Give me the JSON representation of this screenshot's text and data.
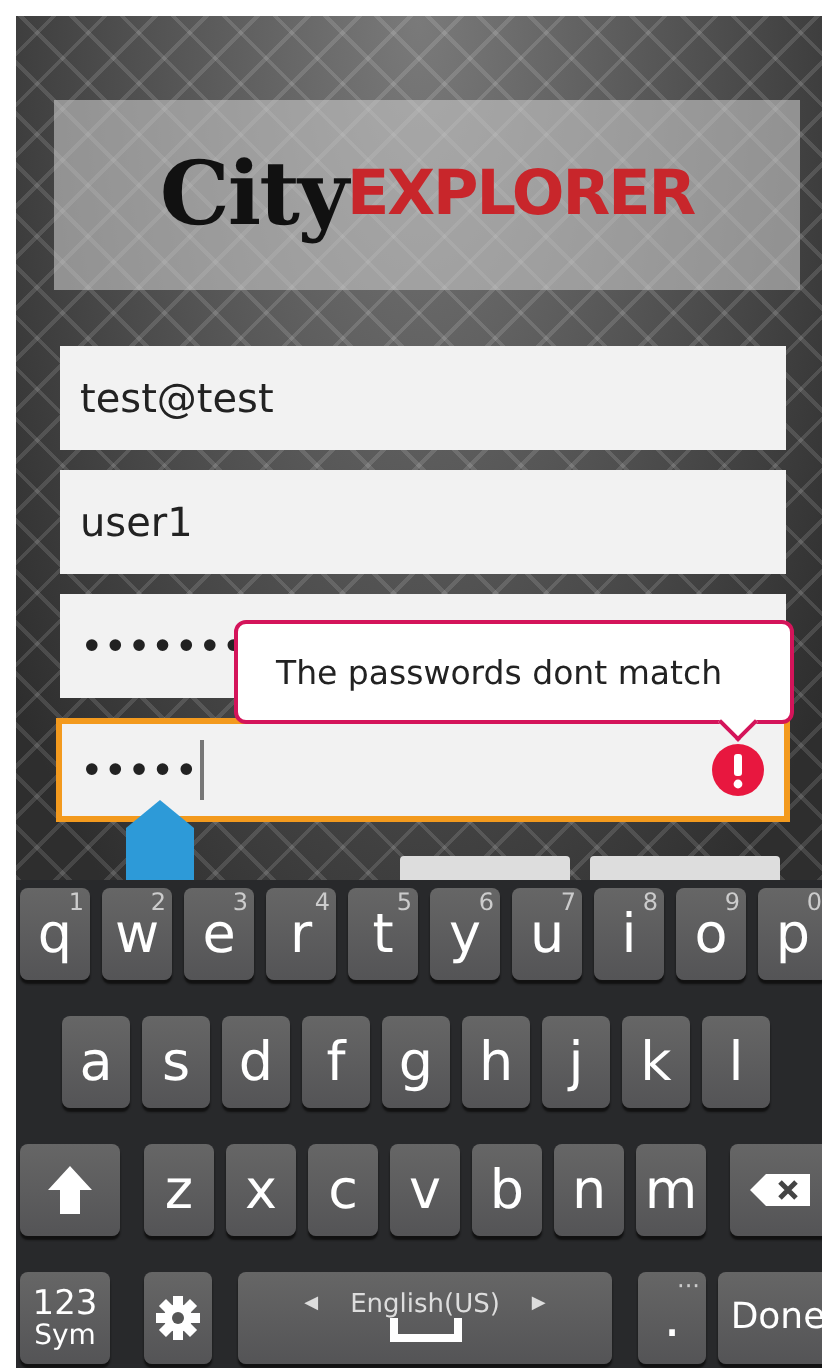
{
  "logo": {
    "word_1": "City",
    "word_2": "EXPLORER"
  },
  "fields": [
    {
      "value": "test@test",
      "focused": false
    },
    {
      "value": "user1",
      "focused": false
    },
    {
      "value": "•••••••",
      "focused": false
    },
    {
      "value": "•••••",
      "focused": true
    }
  ],
  "error_tooltip": {
    "text": "The passwords dont match"
  },
  "keyboard": {
    "letter_rows": [
      {
        "keys": [
          {
            "kind": "char",
            "label": "q",
            "hint": "1"
          },
          {
            "kind": "char",
            "label": "w",
            "hint": "2"
          },
          {
            "kind": "char",
            "label": "e",
            "hint": "3"
          },
          {
            "kind": "char",
            "label": "r",
            "hint": "4"
          },
          {
            "kind": "char",
            "label": "t",
            "hint": "5"
          },
          {
            "kind": "char",
            "label": "y",
            "hint": "6"
          },
          {
            "kind": "char",
            "label": "u",
            "hint": "7"
          },
          {
            "kind": "char",
            "label": "i",
            "hint": "8"
          },
          {
            "kind": "char",
            "label": "o",
            "hint": "9"
          },
          {
            "kind": "char",
            "label": "p",
            "hint": "0"
          }
        ]
      },
      {
        "keys": [
          {
            "kind": "char",
            "label": "a"
          },
          {
            "kind": "char",
            "label": "s"
          },
          {
            "kind": "char",
            "label": "d"
          },
          {
            "kind": "char",
            "label": "f"
          },
          {
            "kind": "char",
            "label": "g"
          },
          {
            "kind": "char",
            "label": "h"
          },
          {
            "kind": "char",
            "label": "j"
          },
          {
            "kind": "char",
            "label": "k"
          },
          {
            "kind": "char",
            "label": "l"
          }
        ]
      },
      {
        "keys": [
          {
            "kind": "shift"
          },
          {
            "kind": "char",
            "label": "z"
          },
          {
            "kind": "char",
            "label": "x"
          },
          {
            "kind": "char",
            "label": "c"
          },
          {
            "kind": "char",
            "label": "v"
          },
          {
            "kind": "char",
            "label": "b"
          },
          {
            "kind": "char",
            "label": "n"
          },
          {
            "kind": "char",
            "label": "m"
          },
          {
            "kind": "backspace"
          }
        ]
      }
    ],
    "bottom_row": {
      "symbols_key": {
        "label": "123",
        "label_2": "Sym"
      },
      "space_key": {
        "label": "English(US)",
        "left": "◀",
        "right": "▶"
      },
      "period_key": {
        "label": ".",
        "hint": "···"
      },
      "done_key": {
        "label": "Done"
      }
    }
  }
}
